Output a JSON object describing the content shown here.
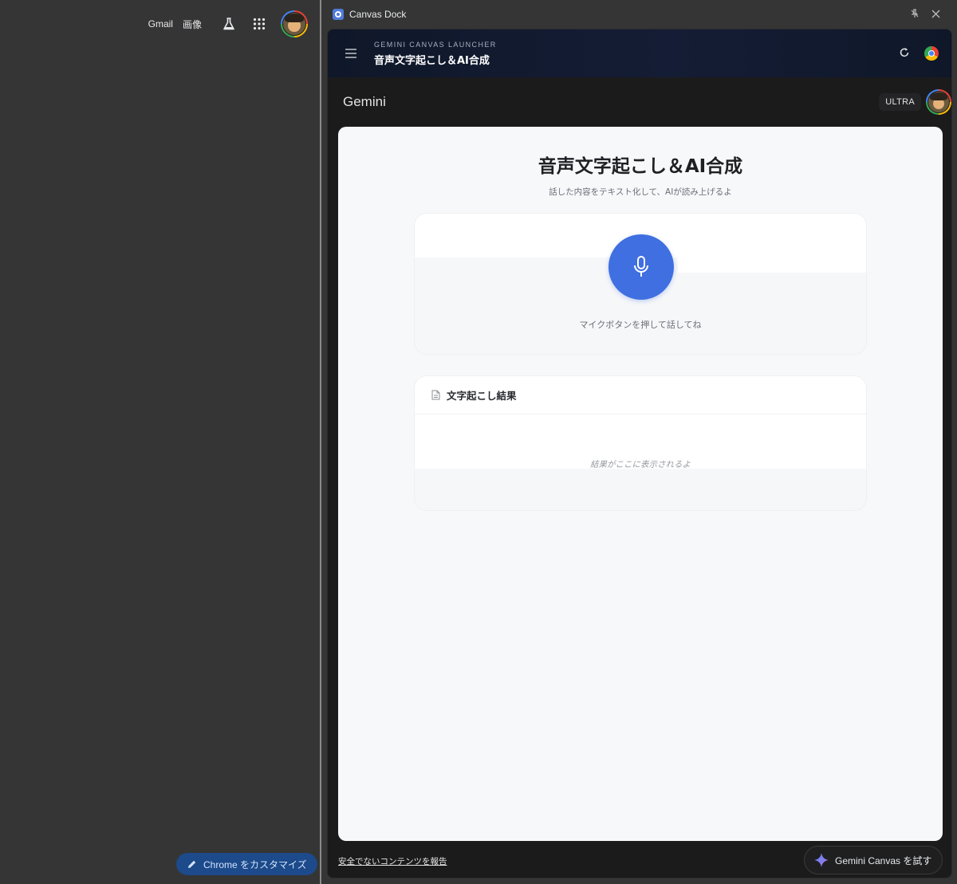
{
  "browser_topbar": {
    "gmail_label": "Gmail",
    "images_label": "画像",
    "labs_icon": "flask-icon",
    "apps_icon": "apps-grid-icon",
    "avatar_icon": "profile-avatar"
  },
  "customize_button": {
    "label": "Chrome をカスタマイズ",
    "icon": "pencil-icon"
  },
  "side_panel": {
    "title": "Canvas Dock",
    "pin_icon": "unpin-icon",
    "close_icon": "close-icon"
  },
  "launcher": {
    "kicker": "GEMINI CANVAS LAUNCHER",
    "title": "音声文字起こし＆AI合成",
    "menu_icon": "hamburger-icon",
    "refresh_icon": "refresh-icon",
    "browser_icon": "chrome-icon"
  },
  "gemini_header": {
    "title": "Gemini",
    "plan_badge": "ULTRA"
  },
  "app": {
    "title": "音声文字起こし＆AI合成",
    "subtitle": "話した内容をテキスト化して、AIが読み上げるよ",
    "mic_hint": "マイクボタンを押して話してね",
    "result_title": "文字起こし結果",
    "result_placeholder": "結果がここに表示されるよ"
  },
  "footer": {
    "report_link": "安全でないコンテンツを報告",
    "try_button": "Gemini Canvas を試す"
  },
  "colors": {
    "accent": "#3f6fe0",
    "canvas_bg": "#f7f8fa",
    "dark_bg": "#1b1b1c"
  }
}
